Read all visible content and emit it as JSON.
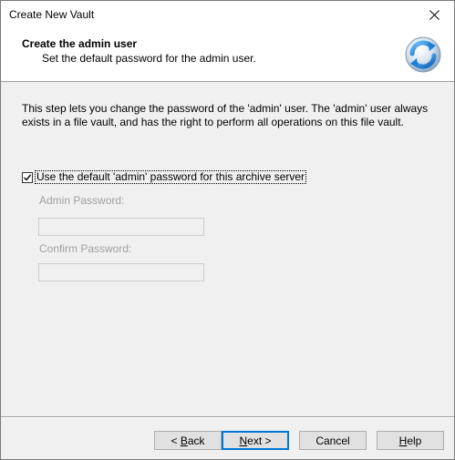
{
  "window": {
    "title": "Create New Vault"
  },
  "header": {
    "title": "Create the admin user",
    "subtitle": "Set the default password for the admin user.",
    "icon": "refresh-arrows-icon"
  },
  "description": "This step lets you change the password of the 'admin' user. The 'admin' user always exists in a file vault, and has the right to perform all operations on this file vault.",
  "use_default": {
    "label": "Use the default 'admin' password for this archive server",
    "checked": true
  },
  "admin_password": {
    "label": "Admin Password:",
    "value": ""
  },
  "confirm_password": {
    "label": "Confirm Password:",
    "value": ""
  },
  "buttons": {
    "back": {
      "prefix": "< ",
      "accel": "B",
      "rest": "ack"
    },
    "next": {
      "accel": "N",
      "rest": "ext >"
    },
    "cancel": "Cancel",
    "help": {
      "accel": "H",
      "rest": "elp"
    }
  },
  "colors": {
    "accent": "#0078d7",
    "disabled_text": "#a0a0a0"
  }
}
